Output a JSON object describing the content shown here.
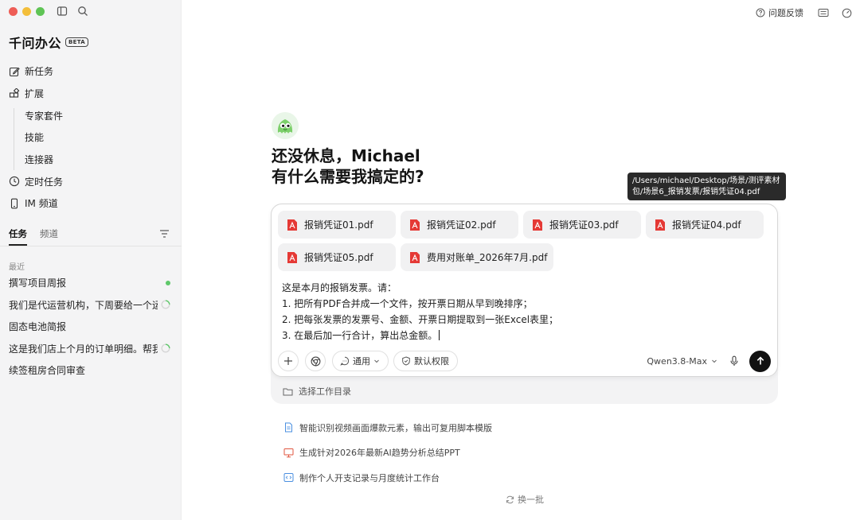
{
  "sidebar": {
    "brand": "千问办公",
    "beta": "BETA",
    "nav": [
      {
        "label": "新任务",
        "icon": "edit-icon"
      },
      {
        "label": "扩展",
        "icon": "extensions-icon"
      },
      {
        "label": "专家套件"
      },
      {
        "label": "技能"
      },
      {
        "label": "连接器"
      },
      {
        "label": "定时任务",
        "icon": "clock-icon"
      },
      {
        "label": "IM 频道",
        "icon": "phone-icon"
      }
    ],
    "tabs": [
      "任务",
      "频道"
    ],
    "recent_label": "最近",
    "recent": [
      {
        "title": "撰写项目周报",
        "status": "done"
      },
      {
        "title": "我们是代运营机构，下周要给一个运",
        "status": "running"
      },
      {
        "title": "固态电池简报",
        "status": "none"
      },
      {
        "title": "这是我们店上个月的订单明细。帮我",
        "status": "running"
      },
      {
        "title": "续签租房合同审查",
        "status": "none"
      }
    ]
  },
  "header": {
    "feedback": "问题反馈"
  },
  "main": {
    "greeting_line1": "还没休息，Michael",
    "greeting_line2": "有什么需要我搞定的?",
    "tooltip": "/Users/michael/Desktop/场景/测评素材包/场景6_报销发票/报销凭证04.pdf",
    "files": [
      "报销凭证01.pdf",
      "报销凭证02.pdf",
      "报销凭证03.pdf",
      "报销凭证04.pdf",
      "报销凭证05.pdf",
      "费用对账单_2026年7月.pdf"
    ],
    "prompt": [
      "这是本月的报销发票。请：",
      "1. 把所有PDF合并成一个文件，按开票日期从早到晚排序；",
      "2. 把每张发票的发票号、金额、开票日期提取到一张Excel表里；",
      "3. 在最后加一行合计，算出总金额。"
    ],
    "mode": "通用",
    "permission": "默认权限",
    "model": "Qwen3.8-Max",
    "workdir": "选择工作目录",
    "suggestions": [
      {
        "label": "智能识别视频画面爆款元素，输出可复用脚本模版",
        "icon": "document-icon"
      },
      {
        "label": "生成针对2026年最新AI趋势分析总结PPT",
        "icon": "presentation-icon"
      },
      {
        "label": "制作个人开支记录与月度统计工作台",
        "icon": "code-icon"
      }
    ],
    "refresh": "换一批"
  },
  "colors": {
    "sidebar_bg": "#f4f4f5",
    "pdf_red": "#e53935",
    "status_green": "#5fc86a",
    "send_button": "#111111"
  }
}
